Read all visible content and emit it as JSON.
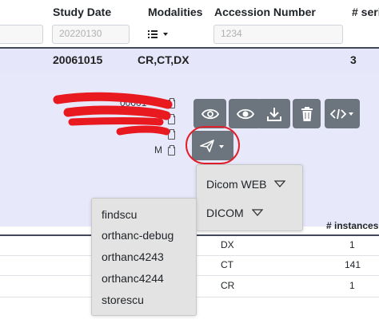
{
  "columns": {
    "study_date": "Study Date",
    "modalities": "Modalities",
    "accession_number": "Accession Number",
    "series": "# seri"
  },
  "filters": {
    "study_date_placeholder": "20220130",
    "accession_placeholder": "1234"
  },
  "study": {
    "date": "20061015",
    "modalities": "CR,CT,DX",
    "series_count": "3"
  },
  "details": {
    "partial_text": "00001",
    "label_m": "M"
  },
  "send_menu": {
    "items": [
      "Dicom WEB",
      "DICOM"
    ]
  },
  "dicom_menu": {
    "items": [
      "findscu",
      "orthanc-debug",
      "orthanc4243",
      "orthanc4244",
      "storescu"
    ]
  },
  "series_table": {
    "header_instances": "# instances",
    "rows": [
      {
        "modality": "DX",
        "instances": "1"
      },
      {
        "modality": "CT",
        "instances": "141"
      },
      {
        "modality": "CR",
        "instances": "1"
      }
    ]
  },
  "colors": {
    "button_bg": "#6c757d",
    "highlight_ring": "#e0202a",
    "redaction": "#e8191f",
    "study_row_bg": "#e6e6fa"
  }
}
